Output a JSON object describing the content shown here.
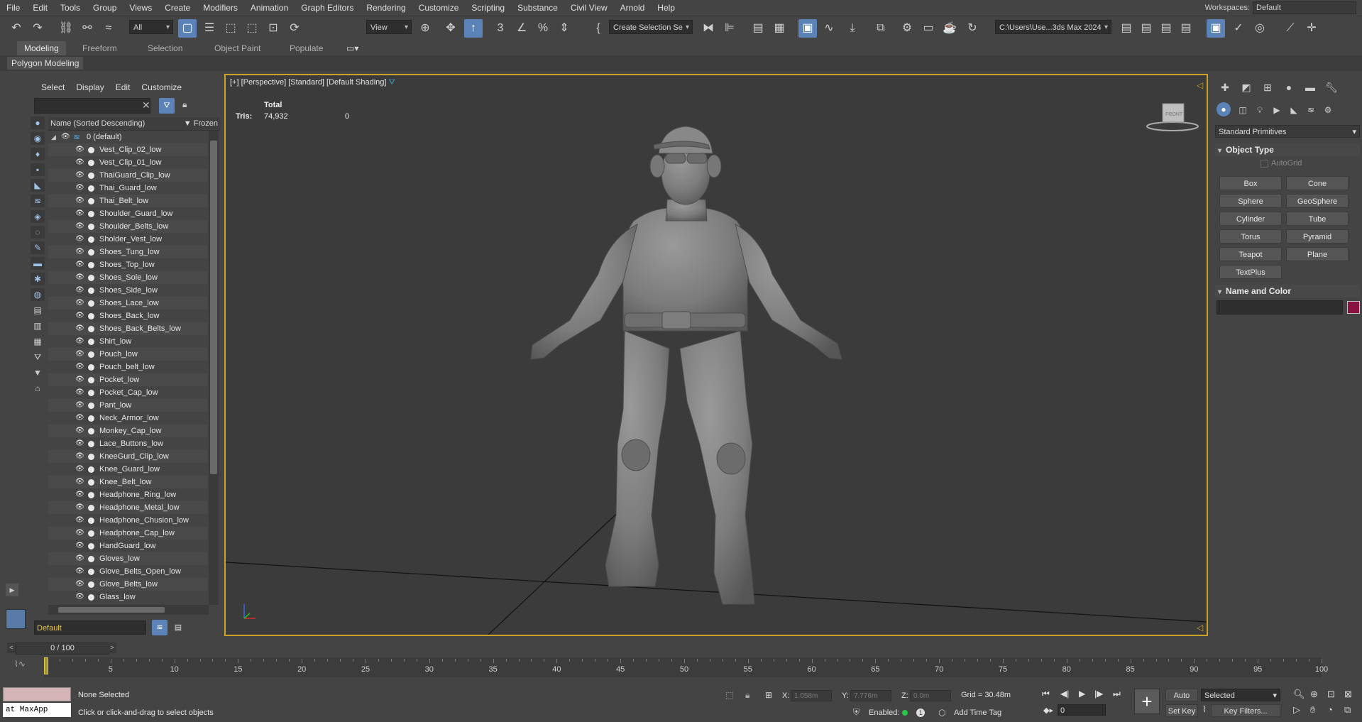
{
  "menu": [
    "File",
    "Edit",
    "Tools",
    "Group",
    "Views",
    "Create",
    "Modifiers",
    "Animation",
    "Graph Editors",
    "Rendering",
    "Customize",
    "Scripting",
    "Substance",
    "Civil View",
    "Arnold",
    "Help"
  ],
  "workspace": {
    "label": "Workspaces:",
    "value": "Default"
  },
  "toolbar": {
    "filter_value": "All",
    "refcoord_value": "View",
    "selection_set_placeholder": "Create Selection Se",
    "project_path": "C:\\Users\\Use...3ds Max 2024"
  },
  "ribbon": {
    "tabs": [
      "Modeling",
      "Freeform",
      "Selection",
      "Object Paint",
      "Populate"
    ],
    "active_tab": "Modeling",
    "panel_label": "Polygon Modeling"
  },
  "explorer": {
    "menu": [
      "Select",
      "Display",
      "Edit",
      "Customize"
    ],
    "header_name": "Name (Sorted Descending)",
    "header_frozen": "Frozen",
    "layer_name": "0 (default)",
    "items": [
      "Vest_Clip_02_low",
      "Vest_Clip_01_low",
      "ThaiGuard_Clip_low",
      "Thai_Guard_low",
      "Thai_Belt_low",
      "Shoulder_Guard_low",
      "Shoulder_Belts_low",
      "Sholder_Vest_low",
      "Shoes_Tung_low",
      "Shoes_Top_low",
      "Shoes_Sole_low",
      "Shoes_Side_low",
      "Shoes_Lace_low",
      "Shoes_Back_low",
      "Shoes_Back_Belts_low",
      "Shirt_low",
      "Pouch_low",
      "Pouch_belt_low",
      "Pocket_low",
      "Pocket_Cap_low",
      "Pant_low",
      "Neck_Armor_low",
      "Monkey_Cap_low",
      "Lace_Buttons_low",
      "KneeGurd_Clip_low",
      "Knee_Guard_low",
      "Knee_Belt_low",
      "Headphone_Ring_low",
      "Headphone_Metal_low",
      "Headphone_Chusion_low",
      "Headphone_Cap_low",
      "HandGuard_low",
      "Gloves_low",
      "Glove_Belts_Open_low",
      "Glove_Belts_low",
      "Glass_low"
    ],
    "layer_dropdown": "Default"
  },
  "viewport": {
    "label": "[+] [Perspective] [Standard] [Default Shading]",
    "stats_total_label": "Total",
    "stats_tris_label": "Tris:",
    "stats_tris_total": "74,932",
    "stats_tris_selected": "0",
    "viewcube_label": "FRONT"
  },
  "command_panel": {
    "category": "Standard Primitives",
    "object_type_title": "Object Type",
    "autogrid": "AutoGrid",
    "buttons": [
      "Box",
      "Cone",
      "Sphere",
      "GeoSphere",
      "Cylinder",
      "Tube",
      "Torus",
      "Pyramid",
      "Teapot",
      "Plane",
      "TextPlus"
    ],
    "name_color_title": "Name and Color",
    "object_color": "#8a1240"
  },
  "timeline": {
    "frame_display": "0 / 100",
    "ticks": [
      5,
      10,
      15,
      20,
      25,
      30,
      35,
      40,
      45,
      50,
      55,
      60,
      65,
      70,
      75,
      80,
      85,
      90,
      95,
      100
    ]
  },
  "status": {
    "maxscript_text": "at MaxApp",
    "selection": "None Selected",
    "prompt": "Click or click-and-drag to select objects",
    "x_label": "X:",
    "x_value": "1.058m",
    "y_label": "Y:",
    "y_value": "7.776m",
    "z_label": "Z:",
    "z_value": "0.0m",
    "grid": "Grid = 30.48m",
    "enabled": "Enabled:",
    "add_time_tag": "Add Time Tag",
    "current_frame": "0",
    "auto_key": "Auto Key",
    "set_key": "Set Key",
    "selected_dd": "Selected",
    "key_filters": "Key Filters..."
  }
}
